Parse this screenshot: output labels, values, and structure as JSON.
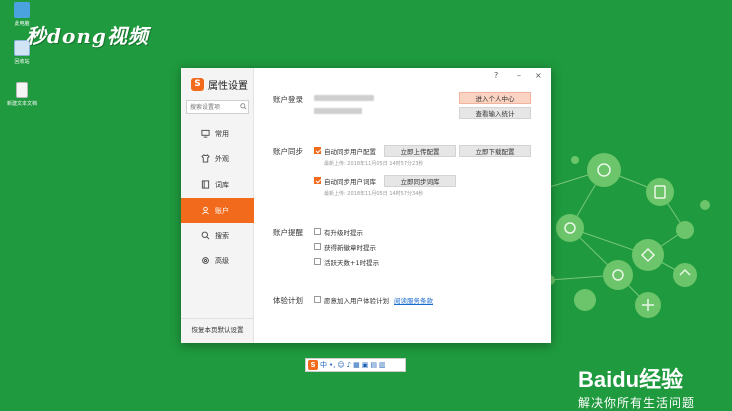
{
  "desktop": {
    "watermark": "秒dong视频",
    "icons": [
      {
        "label": "此电脑",
        "icon": "computer-icon",
        "color": "#4aa3df"
      },
      {
        "label": "回收站",
        "icon": "recycle-bin-icon",
        "color": "#d0e4f5"
      },
      {
        "label": "新建文本文档",
        "icon": "text-file-icon",
        "color": "#f5f5f5"
      }
    ],
    "baidu_logo": "Baidu经验",
    "baidu_slogan": "解决你所有生活问题",
    "tray": {
      "logo": "S",
      "lang": "中"
    }
  },
  "dialog": {
    "title": "属性设置",
    "logo_letter": "S",
    "search_placeholder": "搜索设置项",
    "window_controls": {
      "help": "?",
      "minimize": "–",
      "close": "×"
    },
    "sidebar": [
      {
        "label": "常用",
        "icon": "monitor-icon"
      },
      {
        "label": "外观",
        "icon": "shirt-icon"
      },
      {
        "label": "词库",
        "icon": "book-icon"
      },
      {
        "label": "账户",
        "icon": "user-icon",
        "active": true
      },
      {
        "label": "搜索",
        "icon": "search-icon"
      },
      {
        "label": "高级",
        "icon": "gear-icon"
      }
    ],
    "reset_label": "恢复本页默认设置",
    "account_login": {
      "label": "账户登录",
      "btn_personal_center": "进入个人中心",
      "btn_input_stats": "查看输入统计"
    },
    "account_sync": {
      "label": "账户同步",
      "config": {
        "label": "自动同步用户配置",
        "checked": true,
        "last_upload": "最新上传: 2018年11月05日 14时57分23秒",
        "btn_upload": "立即上传配置",
        "btn_download": "立即下载配置"
      },
      "dict": {
        "label": "自动同步用户词库",
        "checked": true,
        "last_upload": "最新上传: 2018年11月05日 14时57分34秒",
        "btn_sync": "立即同步词库"
      }
    },
    "account_reminder": {
      "label": "账户提醒",
      "options": [
        {
          "label": "有升级时提示",
          "checked": false
        },
        {
          "label": "获得新徽章时提示",
          "checked": false
        },
        {
          "label": "活跃天数+1时提示",
          "checked": false
        }
      ]
    },
    "experience": {
      "label": "体验计划",
      "option": {
        "label": "愿意加入用户体验计划",
        "checked": false
      },
      "link": "阅读服务条款"
    }
  }
}
